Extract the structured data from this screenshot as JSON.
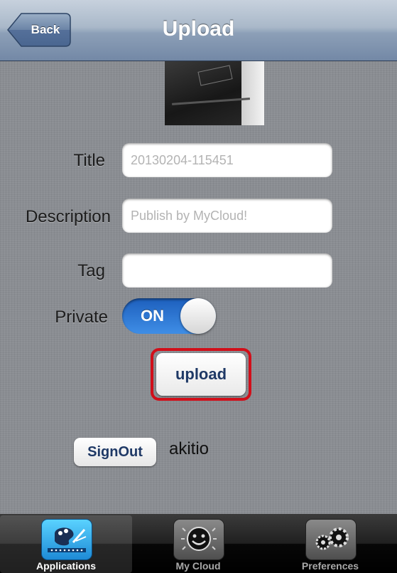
{
  "nav": {
    "title": "Upload",
    "back_label": "Back"
  },
  "form": {
    "title_label": "Title",
    "title_placeholder": "20130204-115451",
    "description_label": "Description",
    "description_placeholder": "Publish by MyCloud!",
    "tag_label": "Tag",
    "tag_value": "",
    "private_label": "Private",
    "private_toggle": "ON"
  },
  "actions": {
    "upload_label": "upload",
    "signout_label": "SignOut",
    "username": "akitio"
  },
  "tabs": [
    {
      "label": "Applications",
      "icon": "palette-icon",
      "selected": true
    },
    {
      "label": "My Cloud",
      "icon": "smiley-cloud-icon",
      "selected": false
    },
    {
      "label": "Preferences",
      "icon": "gears-icon",
      "selected": false
    }
  ],
  "colors": {
    "highlight_border": "#d10f1a",
    "toggle_on": "#2f7ad6",
    "nav_bar": "#8c9fb7"
  }
}
